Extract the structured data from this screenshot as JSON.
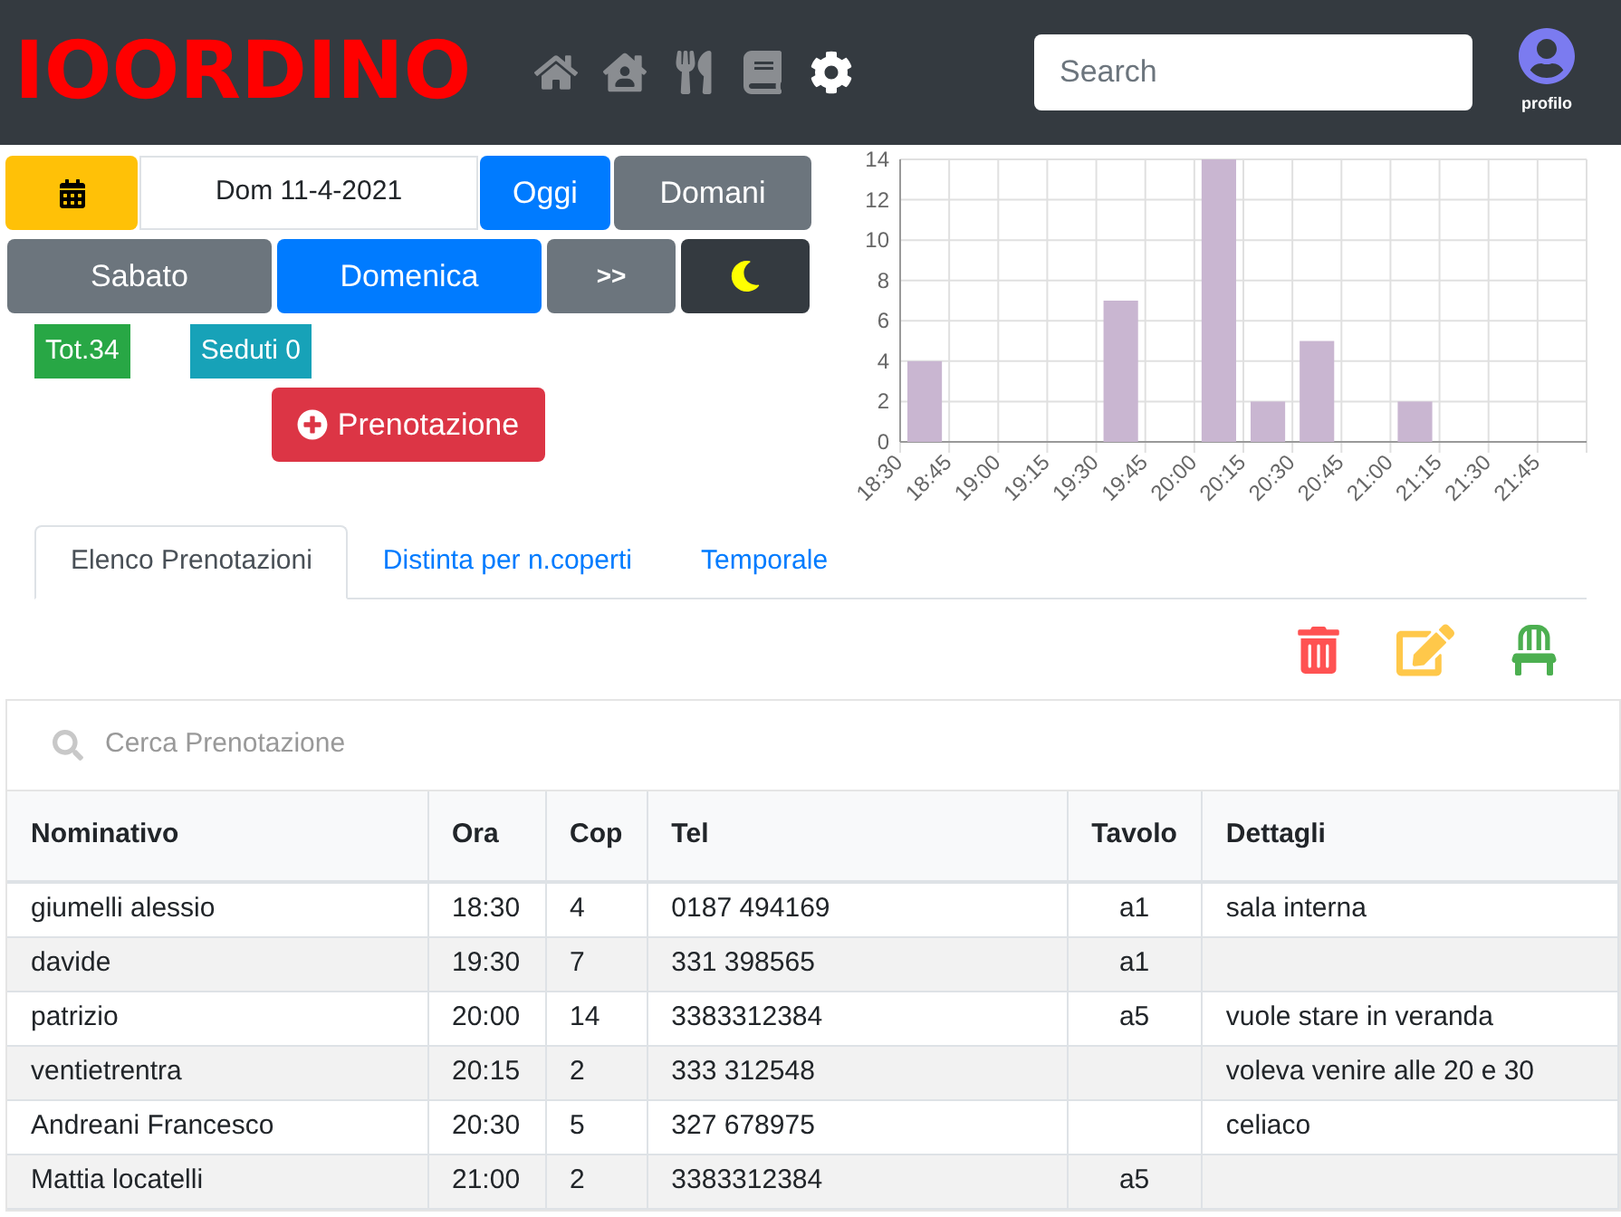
{
  "header": {
    "logo": "IOORDINO",
    "nav": [
      {
        "selected": false
      },
      {
        "selected": false
      },
      {
        "selected": false
      },
      {
        "selected": false
      },
      {
        "selected": true
      }
    ],
    "search": {
      "placeholder": "Search"
    },
    "profile": {
      "label": "profilo"
    }
  },
  "date_bar": {
    "date": "Dom 11-4-2021",
    "today": "Oggi",
    "tomorrow": "Domani"
  },
  "days": [
    {
      "label": "Sabato",
      "selected": false
    },
    {
      "label": "Domenica",
      "selected": true
    },
    {
      "label": ">>",
      "selected": false
    }
  ],
  "badges": [
    {
      "label": "Tot.34",
      "color": "#28a745"
    },
    {
      "label": "Seduti 0",
      "color": "#17a2b8"
    }
  ],
  "new_booking": "Prenotazione",
  "chart": {
    "chart_data": {
      "type": "bar",
      "categories": [
        "18:30",
        "18:45",
        "19:00",
        "19:15",
        "19:30",
        "19:45",
        "20:00",
        "20:15",
        "20:30",
        "20:45",
        "21:00",
        "21:15",
        "21:30",
        "21:45"
      ],
      "grid": true,
      "series": [
        {
          "color": "#c9b6d1",
          "values": [
            4,
            0,
            0,
            0,
            7,
            0,
            14,
            2,
            5,
            0,
            2,
            0,
            0,
            0
          ]
        }
      ],
      "ylim": [
        0,
        14
      ],
      "yticks": [
        0,
        2,
        4,
        6,
        8,
        10,
        12,
        14
      ]
    }
  },
  "tabs": [
    {
      "label": "Elenco Prenotazioni",
      "selected": true
    },
    {
      "label": "Distinta per n.coperti",
      "selected": false
    },
    {
      "label": "Temporale",
      "selected": false
    }
  ],
  "table_search": {
    "placeholder": "Cerca Prenotazione"
  },
  "table": {
    "columns": [
      "Nominativo",
      "Ora",
      "Cop",
      "Tel",
      "Tavolo",
      "Dettagli"
    ],
    "rows": [
      [
        "giumelli alessio",
        "18:30",
        "4",
        "0187 494169",
        "a1",
        "sala interna"
      ],
      [
        "davide",
        "19:30",
        "7",
        "331 398565",
        "a1",
        ""
      ],
      [
        "patrizio",
        "20:00",
        "14",
        "3383312384",
        "a5",
        "vuole stare in veranda"
      ],
      [
        "ventietrentra",
        "20:15",
        "2",
        "333 312548",
        "",
        "voleva venire alle 20 e 30"
      ],
      [
        "Andreani Francesco",
        "20:30",
        "5",
        "327 678975",
        "",
        "celiaco"
      ],
      [
        "Mattia locatelli",
        "21:00",
        "2",
        "3383312384",
        "a5",
        ""
      ]
    ]
  }
}
